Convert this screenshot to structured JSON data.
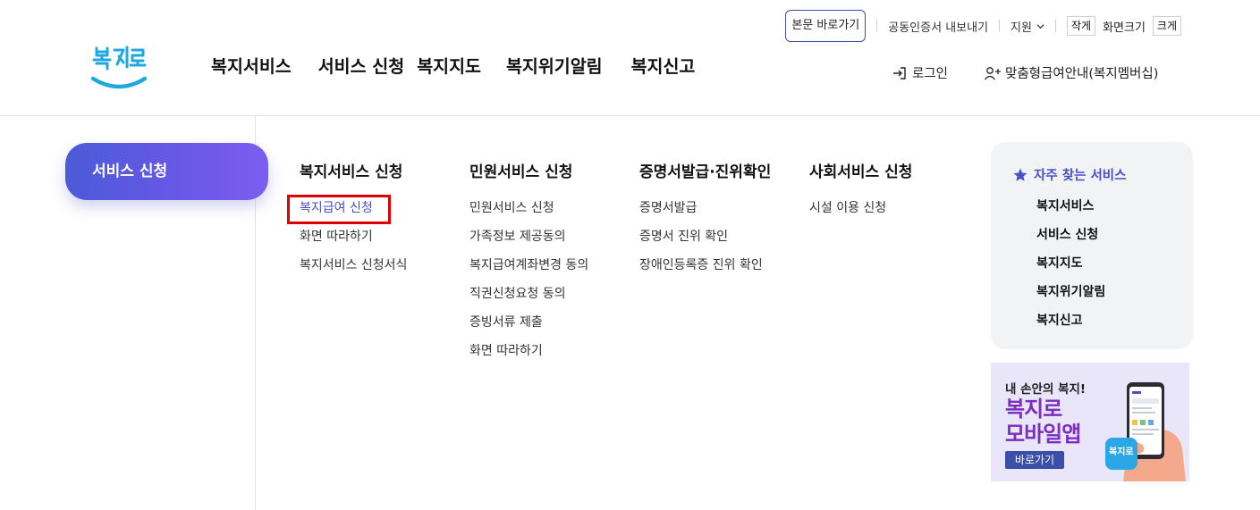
{
  "header": {
    "logo_text": "복지로",
    "util": {
      "skip_to_content": "본문 바로가기",
      "cert_export": "공동인증서 내보내기",
      "support": "지원",
      "font_small": "작게",
      "font_size_label": "화면크기",
      "font_large": "크게"
    },
    "gnb": [
      "복지서비스",
      "서비스 신청",
      "복지지도",
      "복지위기알림",
      "복지신고"
    ],
    "login": "로그인",
    "membership": "맞춤형급여안내(복지멤버십)"
  },
  "side": {
    "active_title": "서비스 신청"
  },
  "menu_columns": [
    {
      "title": "복지서비스 신청",
      "items": [
        "복지급여 신청",
        "화면 따라하기",
        "복지서비스 신청서식"
      ]
    },
    {
      "title": "민원서비스 신청",
      "items": [
        "민원서비스 신청",
        "가족정보 제공동의",
        "복지급여계좌변경 동의",
        "직권신청요청 동의",
        "증빙서류 제출",
        "화면 따라하기"
      ]
    },
    {
      "title": "증명서발급·진위확인",
      "items": [
        "증명서발급",
        "증명서 진위 확인",
        "장애인등록증 진위 확인"
      ]
    },
    {
      "title": "사회서비스 신청",
      "items": [
        "시설 이용 신청"
      ]
    }
  ],
  "quick": {
    "title": "자주 찾는 서비스",
    "items": [
      "복지서비스",
      "서비스 신청",
      "복지지도",
      "복지위기알림",
      "복지신고"
    ]
  },
  "banner": {
    "line1": "내 손안의 복지!",
    "line2": "복지로",
    "line3": "모바일앱",
    "button": "바로가기",
    "badge": "복지로"
  },
  "colors": {
    "accent": "#4a4fc9",
    "highlight": "#e10000",
    "side_gradient_start": "#4a5bd6",
    "side_gradient_end": "#7b5ef0",
    "banner_purple": "#7a2fc0"
  }
}
